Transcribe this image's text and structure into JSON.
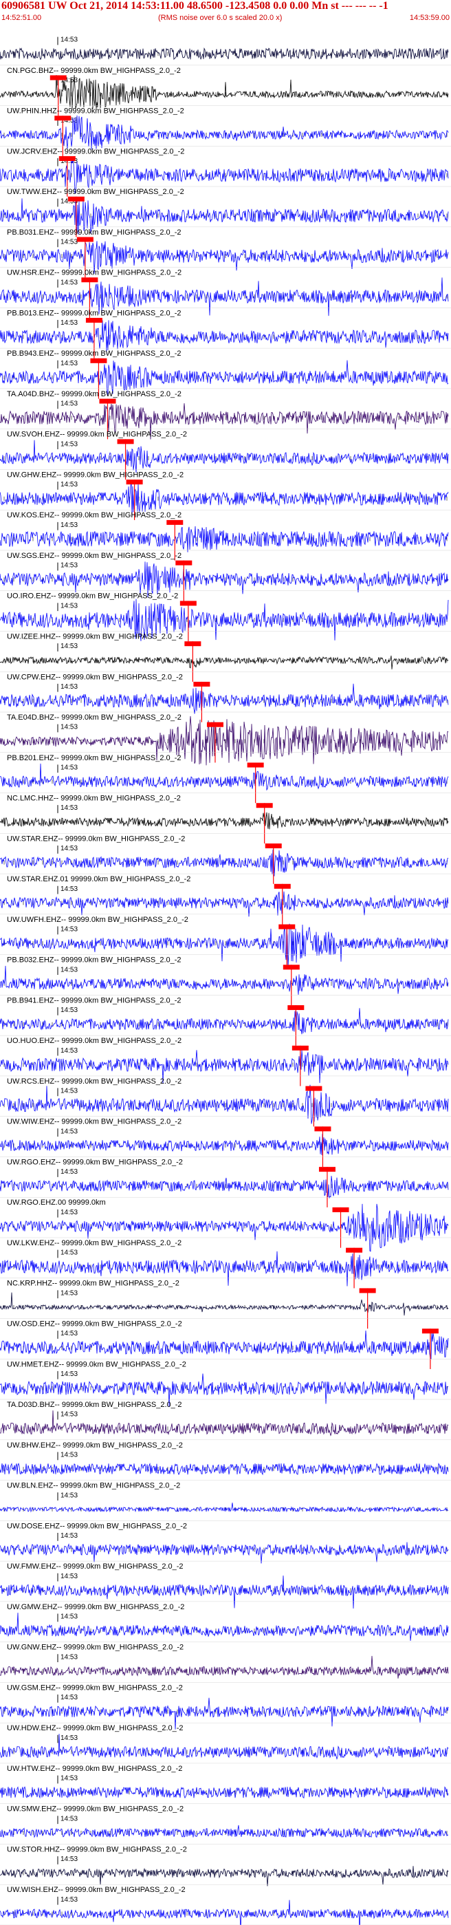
{
  "header": {
    "title": "60906581 UW Oct 21, 2014 14:53:11.00    48.6500 -123.4508  0.0 0.00 Mn st --- --- -- -1",
    "start_time": "14:52:51.00",
    "note": "(RMS noise over 6.0 s scaled 20.0 x)",
    "end_time": "14:53:59.00"
  },
  "chart_data": {
    "type": "seismogram",
    "tick_label": "14:53",
    "colors": {
      "blue": "#0000ff",
      "dark": "#000033",
      "purple": "#330066",
      "pick": "#ff0000"
    },
    "traces": [
      {
        "label": "",
        "color": "#000033",
        "amp": 0.25,
        "pick": null,
        "burst": null
      },
      {
        "label": "CN.PGC.BHZ-- 99999.0km BW_HIGHPASS_2.0_-2",
        "color": "#000000",
        "amp": 0.15,
        "pick": 0.13,
        "burst": [
          0.12,
          0.35,
          1.0
        ]
      },
      {
        "label": "UW.PHIN.HHZ-- 99999.0km BW_HIGHPASS_2.0_-2",
        "color": "#0000ff",
        "amp": 0.2,
        "pick": 0.14,
        "burst": [
          0.13,
          0.3,
          1.0
        ]
      },
      {
        "label": "UW.JCRV.EHZ-- 99999.0km BW_HIGHPASS_2.0_-2",
        "color": "#0000ff",
        "amp": 0.3,
        "pick": 0.15,
        "burst": [
          0.14,
          0.25,
          0.8
        ]
      },
      {
        "label": "UW.TWW.EHZ-- 99999.0km BW_HIGHPASS_2.0_-2",
        "color": "#0000ff",
        "amp": 0.3,
        "pick": 0.17,
        "burst": [
          0.16,
          0.24,
          0.8
        ]
      },
      {
        "label": "PB.B031.EHZ-- 99999.0km BW_HIGHPASS_2.0_-2",
        "color": "#0000ff",
        "amp": 0.3,
        "pick": 0.19,
        "burst": [
          0.18,
          0.3,
          0.8
        ]
      },
      {
        "label": "UW.HSR.EHZ-- 99999.0km BW_HIGHPASS_2.0_-2",
        "color": "#0000ff",
        "amp": 0.3,
        "pick": 0.2,
        "burst": [
          0.2,
          0.32,
          0.7
        ]
      },
      {
        "label": "PB.B013.EHZ-- 99999.0km BW_HIGHPASS_2.0_-2",
        "color": "#0000ff",
        "amp": 0.3,
        "pick": 0.21,
        "burst": [
          0.21,
          0.34,
          0.7
        ]
      },
      {
        "label": "PB.B943.EHZ-- 99999.0km BW_HIGHPASS_2.0_-2",
        "color": "#0000ff",
        "amp": 0.3,
        "pick": 0.22,
        "burst": [
          0.22,
          0.34,
          0.7
        ]
      },
      {
        "label": "TA.A04D.BHZ-- 99999.0km BW_HIGHPASS_2.0_-2",
        "color": "#330066",
        "amp": 0.3,
        "pick": 0.24,
        "burst": [
          0.22,
          0.34,
          0.6
        ]
      },
      {
        "label": "UW.SVOH.EHZ-- 99999.0km BW_HIGHPASS_2.0_-2",
        "color": "#0000ff",
        "amp": 0.25,
        "pick": 0.28,
        "burst": [
          0.28,
          0.34,
          0.8
        ]
      },
      {
        "label": "UW.GHW.EHZ-- 99999.0km BW_HIGHPASS_2.0_-2",
        "color": "#0000ff",
        "amp": 0.3,
        "pick": 0.3,
        "burst": [
          0.28,
          0.36,
          0.8
        ]
      },
      {
        "label": "UW.KOS.EHZ-- 99999.0km BW_HIGHPASS_2.0_-2",
        "color": "#0000ff",
        "amp": 0.35,
        "pick": 0.39,
        "burst": [
          0.4,
          0.5,
          0.6
        ]
      },
      {
        "label": "UW.SGS.EHZ-- 99999.0km BW_HIGHPASS_2.0_-2",
        "color": "#0000ff",
        "amp": 0.3,
        "pick": 0.41,
        "burst": [
          0.3,
          0.43,
          0.8
        ]
      },
      {
        "label": "UO.IRO.EHZ-- 99999.0km BW_HIGHPASS_2.0_-2",
        "color": "#0000ff",
        "amp": 0.35,
        "pick": 0.42,
        "burst": [
          0.28,
          0.43,
          0.9
        ]
      },
      {
        "label": "UW.IZEE.HHZ-- 99999.0km BW_HIGHPASS_2.0_-2",
        "color": "#000000",
        "amp": 0.15,
        "pick": 0.43,
        "burst": [
          0.42,
          0.45,
          0.5
        ]
      },
      {
        "label": "UW.CPW.EHZ-- 99999.0km BW_HIGHPASS_2.0_-2",
        "color": "#0000ff",
        "amp": 0.3,
        "pick": 0.45,
        "burst": [
          0.42,
          0.47,
          0.5
        ]
      },
      {
        "label": "TA.E04D.BHZ-- 99999.0km BW_HIGHPASS_2.0_-2",
        "color": "#330066",
        "amp": 0.2,
        "pick": 0.48,
        "burst": [
          0.34,
          1.0,
          1.2
        ]
      },
      {
        "label": "PB.B201.EHZ-- 99999.0km BW_HIGHPASS_2.0_-2",
        "color": "#0000ff",
        "amp": 0.25,
        "pick": 0.57,
        "burst": [
          0.56,
          0.62,
          0.4
        ]
      },
      {
        "label": "NC.LMC.HHZ-- 99999.0km BW_HIGHPASS_2.0_-2",
        "color": "#000000",
        "amp": 0.2,
        "pick": 0.59,
        "burst": [
          0.58,
          0.63,
          0.4
        ]
      },
      {
        "label": "UW.STAR.EHZ-- 99999.0km BW_HIGHPASS_2.0_-2",
        "color": "#0000ff",
        "amp": 0.25,
        "pick": 0.61,
        "burst": [
          0.6,
          0.66,
          0.6
        ]
      },
      {
        "label": "UW.STAR.EHZ.01 99999.0km BW_HIGHPASS_2.0_-2",
        "color": "#0000ff",
        "amp": 0.25,
        "pick": 0.63,
        "burst": [
          0.61,
          0.66,
          0.6
        ]
      },
      {
        "label": "UW.UWFH.EHZ-- 99999.0km BW_HIGHPASS_2.0_-2",
        "color": "#0000ff",
        "amp": 0.25,
        "pick": 0.64,
        "burst": [
          0.62,
          0.75,
          1.2
        ]
      },
      {
        "label": "PB.B032.EHZ-- 99999.0km BW_HIGHPASS_2.0_-2",
        "color": "#0000ff",
        "amp": 0.25,
        "pick": 0.65,
        "burst": [
          0.64,
          0.7,
          0.5
        ]
      },
      {
        "label": "PB.B941.EHZ-- 99999.0km BW_HIGHPASS_2.0_-2",
        "color": "#0000ff",
        "amp": 0.25,
        "pick": 0.66,
        "burst": [
          0.65,
          0.7,
          0.5
        ]
      },
      {
        "label": "UO.HUO.EHZ-- 99999.0km BW_HIGHPASS_2.0_-2",
        "color": "#0000ff",
        "amp": 0.3,
        "pick": 0.67,
        "burst": [
          0.66,
          0.72,
          0.6
        ]
      },
      {
        "label": "UW.RCS.EHZ-- 99999.0km BW_HIGHPASS_2.0_-2",
        "color": "#0000ff",
        "amp": 0.3,
        "pick": 0.7,
        "burst": [
          0.68,
          0.74,
          0.9
        ]
      },
      {
        "label": "UW.WIW.EHZ-- 99999.0km BW_HIGHPASS_2.0_-2",
        "color": "#0000ff",
        "amp": 0.25,
        "pick": 0.72,
        "burst": [
          0.71,
          0.76,
          0.5
        ]
      },
      {
        "label": "UW.RGO.EHZ-- 99999.0km BW_HIGHPASS_2.0_-2",
        "color": "#0000ff",
        "amp": 0.25,
        "pick": 0.73,
        "burst": [
          0.72,
          0.77,
          0.5
        ]
      },
      {
        "label": "UW.RGO.EHZ.00 99999.0km",
        "color": "#0000ff",
        "amp": 0.25,
        "pick": 0.76,
        "burst": [
          0.77,
          1.0,
          1.3
        ]
      },
      {
        "label": "UW.LKW.EHZ-- 99999.0km BW_HIGHPASS_2.0_-2",
        "color": "#0000ff",
        "amp": 0.3,
        "pick": 0.79,
        "burst": [
          0.78,
          0.84,
          0.6
        ]
      },
      {
        "label": "NC.KRP.HHZ-- 99999.0km BW_HIGHPASS_2.0_-2",
        "color": "#000033",
        "amp": 0.1,
        "pick": 0.82,
        "burst": [
          0.8,
          0.84,
          0.4
        ]
      },
      {
        "label": "UW.OSD.EHZ-- 99999.0km BW_HIGHPASS_2.0_-2",
        "color": "#0000ff",
        "amp": 0.3,
        "pick": 0.96,
        "burst": [
          0.95,
          1.0,
          0.7
        ]
      },
      {
        "label": "UW.HMET.EHZ-- 99999.0km BW_HIGHPASS_2.0_-2",
        "color": "#0000ff",
        "amp": 0.3,
        "pick": null,
        "burst": null
      },
      {
        "label": "TA.D03D.BHZ-- 99999.0km BW_HIGHPASS_2.0_-2",
        "color": "#330066",
        "amp": 0.25,
        "pick": null,
        "burst": null
      },
      {
        "label": "UW.BHW.EHZ-- 99999.0km BW_HIGHPASS_2.0_-2",
        "color": "#0000ff",
        "amp": 0.25,
        "pick": null,
        "burst": null
      },
      {
        "label": "UW.BLN.EHZ-- 99999.0km BW_HIGHPASS_2.0_-2",
        "color": "#0000ff",
        "amp": 0.1,
        "pick": null,
        "burst": null
      },
      {
        "label": "UW.DOSE.EHZ-- 99999.0km BW_HIGHPASS_2.0_-2",
        "color": "#0000ff",
        "amp": 0.25,
        "pick": null,
        "burst": null
      },
      {
        "label": "UW.FMW.EHZ-- 99999.0km BW_HIGHPASS_2.0_-2",
        "color": "#0000ff",
        "amp": 0.25,
        "pick": null,
        "burst": null
      },
      {
        "label": "UW.GMW.EHZ-- 99999.0km BW_HIGHPASS_2.0_-2",
        "color": "#0000ff",
        "amp": 0.25,
        "pick": null,
        "burst": null
      },
      {
        "label": "UW.GNW.EHZ-- 99999.0km BW_HIGHPASS_2.0_-2",
        "color": "#330066",
        "amp": 0.2,
        "pick": null,
        "burst": null
      },
      {
        "label": "UW.GSM.EHZ-- 99999.0km BW_HIGHPASS_2.0_-2",
        "color": "#0000ff",
        "amp": 0.25,
        "pick": null,
        "burst": null
      },
      {
        "label": "UW.HDW.EHZ-- 99999.0km BW_HIGHPASS_2.0_-2",
        "color": "#0000ff",
        "amp": 0.25,
        "pick": null,
        "burst": null
      },
      {
        "label": "UW.HTW.EHZ-- 99999.0km BW_HIGHPASS_2.0_-2",
        "color": "#0000ff",
        "amp": 0.25,
        "pick": null,
        "burst": null
      },
      {
        "label": "UW.SMW.EHZ-- 99999.0km BW_HIGHPASS_2.0_-2",
        "color": "#0000ff",
        "amp": 0.2,
        "pick": null,
        "burst": null
      },
      {
        "label": "UW.STOR.HHZ-- 99999.0km BW_HIGHPASS_2.0_-2",
        "color": "#000033",
        "amp": 0.2,
        "pick": null,
        "burst": null
      },
      {
        "label": "UW.WISH.EHZ-- 99999.0km BW_HIGHPASS_2.0_-2",
        "color": "#0000ff",
        "amp": 0.2,
        "pick": null,
        "burst": null
      }
    ]
  }
}
